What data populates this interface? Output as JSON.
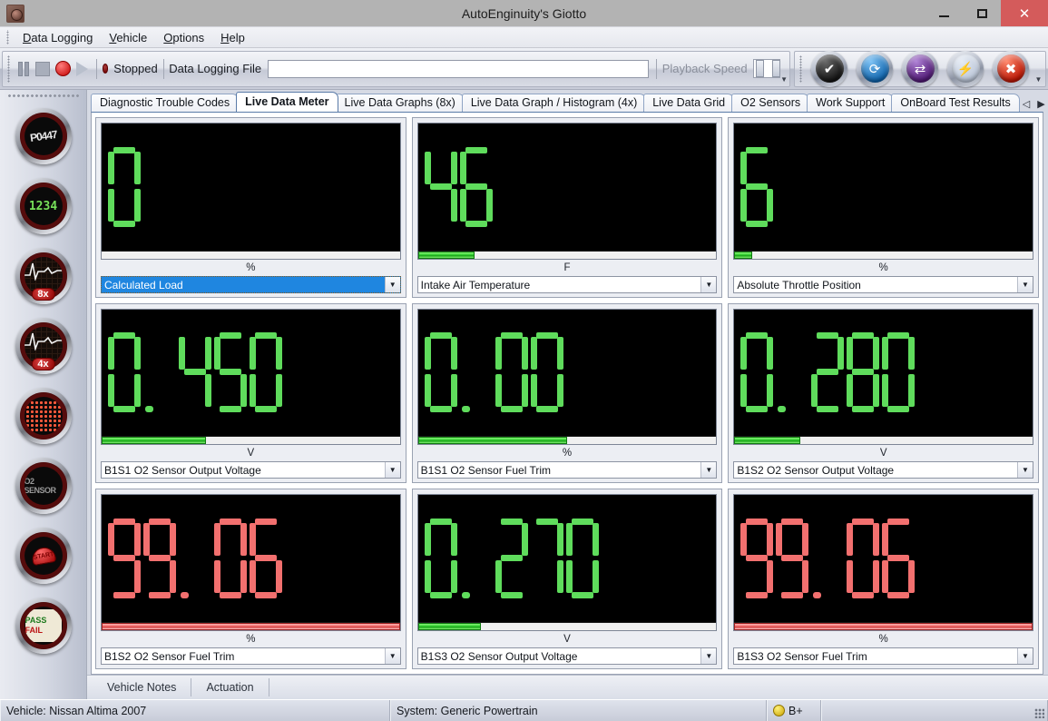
{
  "window": {
    "title": "AutoEnginuity's Giotto",
    "app_icon": "app-logo-icon",
    "minimize": "−",
    "maximize": "□",
    "close": "✕"
  },
  "menu": {
    "items": [
      {
        "label": "Data Logging",
        "accel": "D"
      },
      {
        "label": "Vehicle",
        "accel": "V"
      },
      {
        "label": "Options",
        "accel": "O"
      },
      {
        "label": "Help",
        "accel": "H"
      }
    ]
  },
  "toolbar": {
    "pause": "pause-button",
    "stop": "stop-button",
    "record": "record-button",
    "play": "play-button",
    "status_text": "Stopped",
    "log_file_label": "Data Logging File",
    "log_file_value": "",
    "log_file_placeholder": "",
    "playback_speed_label": "Playback Speed",
    "round_buttons": [
      {
        "name": "diagnostic-report-button",
        "glyph": "✔"
      },
      {
        "name": "refresh-button",
        "glyph": "↻"
      },
      {
        "name": "vehicle-select-button",
        "glyph": "↺"
      },
      {
        "name": "connect-button",
        "glyph": "⚡"
      },
      {
        "name": "disconnect-button",
        "glyph": "✖"
      }
    ]
  },
  "sidebar": {
    "items": [
      {
        "name": "sidebar-icon-trouble-codes",
        "kind": "dtc",
        "text": "P0447"
      },
      {
        "name": "sidebar-icon-live-data-meter",
        "kind": "digits",
        "text": "1234"
      },
      {
        "name": "sidebar-icon-live-data-graphs-8x",
        "kind": "ecg",
        "badge": "8x"
      },
      {
        "name": "sidebar-icon-live-data-graph-histogram-4x",
        "kind": "ecg",
        "badge": "4x"
      },
      {
        "name": "sidebar-icon-live-data-grid",
        "kind": "grid",
        "badge": ""
      },
      {
        "name": "sidebar-icon-o2-sensors",
        "kind": "o2",
        "text": "O2 SENSOR"
      },
      {
        "name": "sidebar-icon-work-support",
        "kind": "start",
        "text": "START"
      },
      {
        "name": "sidebar-icon-onboard-test-results",
        "kind": "passfail",
        "pass": "PASS",
        "fail": "FAIL"
      }
    ]
  },
  "tabs": {
    "items": [
      {
        "label": "Diagnostic Trouble Codes",
        "active": false
      },
      {
        "label": "Live Data Meter",
        "active": true
      },
      {
        "label": "Live Data Graphs (8x)",
        "active": false
      },
      {
        "label": "Live Data Graph / Histogram (4x)",
        "active": false
      },
      {
        "label": "Live Data Grid",
        "active": false
      },
      {
        "label": "O2 Sensors",
        "active": false
      },
      {
        "label": "Work Support",
        "active": false
      },
      {
        "label": "OnBoard Test Results",
        "active": false
      }
    ],
    "scroll_left": "◁",
    "scroll_right": "▶"
  },
  "meters": [
    {
      "value": "0",
      "unit": "%",
      "parameter": "Calculated Load",
      "bar_percent": 0,
      "color": "#5fdc5c",
      "alarm": false,
      "selected": true
    },
    {
      "value": "46",
      "unit": "F",
      "parameter": "Intake Air Temperature",
      "bar_percent": 19,
      "color": "#5fdc5c",
      "alarm": false,
      "selected": false
    },
    {
      "value": "6",
      "unit": "%",
      "parameter": "Absolute Throttle Position",
      "bar_percent": 6,
      "color": "#5fdc5c",
      "alarm": false,
      "selected": false
    },
    {
      "value": "0.450",
      "unit": "V",
      "parameter": "B1S1 O2 Sensor Output Voltage",
      "bar_percent": 35,
      "color": "#5fdc5c",
      "alarm": false,
      "selected": false
    },
    {
      "value": "0.00",
      "unit": "%",
      "parameter": "B1S1 O2 Sensor Fuel Trim",
      "bar_percent": 50,
      "color": "#5fdc5c",
      "alarm": false,
      "selected": false
    },
    {
      "value": "0.280",
      "unit": "V",
      "parameter": "B1S2 O2 Sensor Output Voltage",
      "bar_percent": 22,
      "color": "#5fdc5c",
      "alarm": false,
      "selected": false
    },
    {
      "value": "99.06",
      "unit": "%",
      "parameter": "B1S2 O2 Sensor Fuel Trim",
      "bar_percent": 100,
      "color": "#f2706f",
      "alarm": true,
      "selected": false
    },
    {
      "value": "0.270",
      "unit": "V",
      "parameter": "B1S3 O2 Sensor Output Voltage",
      "bar_percent": 21,
      "color": "#5fdc5c",
      "alarm": false,
      "selected": false
    },
    {
      "value": "99.06",
      "unit": "%",
      "parameter": "B1S3 O2 Sensor Fuel Trim",
      "bar_percent": 100,
      "color": "#f2706f",
      "alarm": true,
      "selected": false
    }
  ],
  "bottom_tabs": {
    "items": [
      {
        "label": "Vehicle Notes"
      },
      {
        "label": "Actuation"
      }
    ]
  },
  "statusbar": {
    "vehicle": "Vehicle: Nissan  Altima  2007",
    "system": "System: Generic Powertrain",
    "battery_label": "B+",
    "battery_color": "#e8c400"
  }
}
